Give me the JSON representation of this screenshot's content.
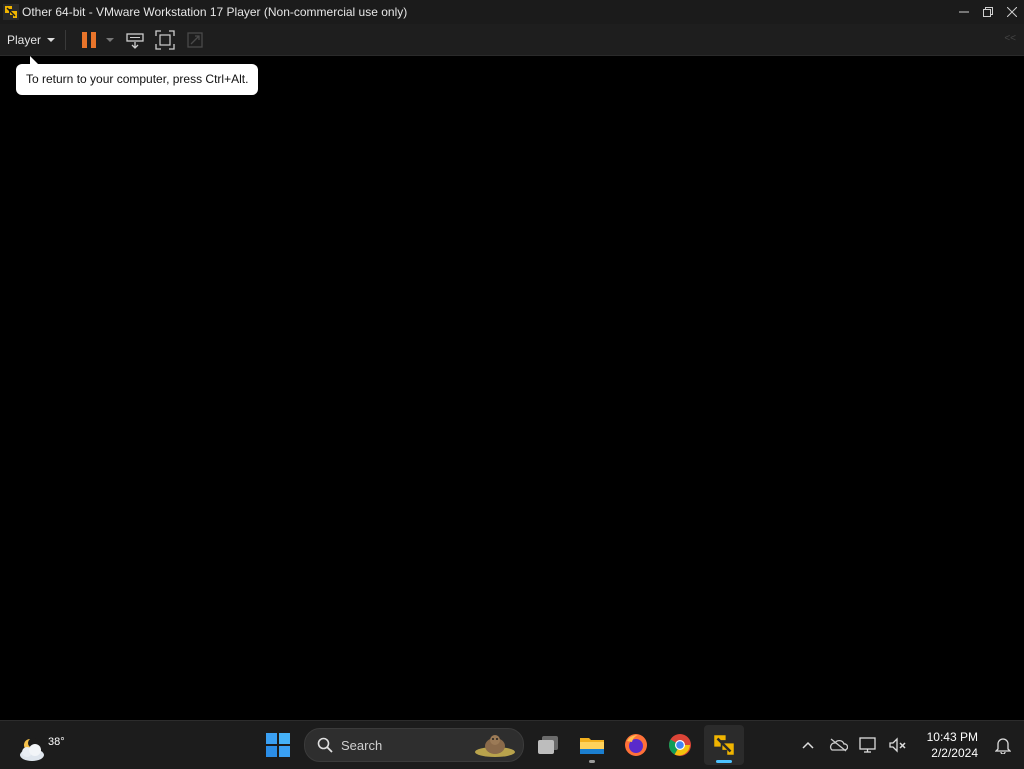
{
  "window": {
    "title": "Other 64-bit - VMware Workstation 17 Player (Non-commercial use only)",
    "icon": "vmware-icon",
    "controls": [
      "minimize-icon",
      "restore-icon",
      "close-icon"
    ]
  },
  "toolbar": {
    "player_menu": "Player",
    "buttons": [
      "pause-icon",
      "send-ctrl-alt-del-icon",
      "fullscreen-icon",
      "unity-icon"
    ],
    "collapse_glyph": "<<"
  },
  "tooltip": {
    "text": "To return to your computer, press Ctrl+Alt."
  },
  "taskbar": {
    "weather": {
      "temp": "38°",
      "icon": "weather-cloud-moon-icon"
    },
    "search": {
      "placeholder": "Search"
    },
    "apps": [
      {
        "name": "task-view",
        "icon": "task-view-icon"
      },
      {
        "name": "file-explorer",
        "icon": "folder-icon"
      },
      {
        "name": "firefox",
        "icon": "firefox-icon"
      },
      {
        "name": "chrome",
        "icon": "chrome-icon"
      },
      {
        "name": "vmware-player",
        "icon": "vmware-icon",
        "active": true
      }
    ],
    "tray": {
      "icons": [
        "chevron-up-icon",
        "onedrive-icon",
        "network-icon",
        "volume-muted-icon",
        "notification-bell-icon"
      ],
      "time": "10:43 PM",
      "date": "2/2/2024"
    }
  },
  "colors": {
    "accent_orange": "#e8742a",
    "vmware_yellow": "#f0b400",
    "taskbar_indicator": "#4cc2ff"
  }
}
